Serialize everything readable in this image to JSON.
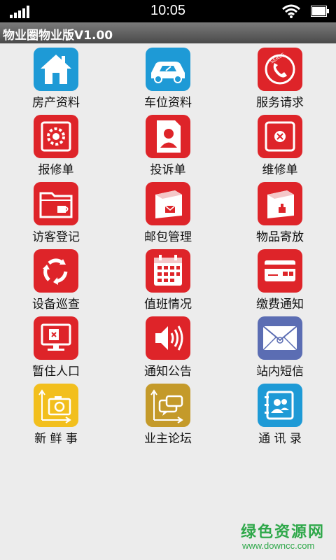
{
  "status_bar": {
    "time": "10:05",
    "icons": [
      "signal-icon",
      "wifi-icon",
      "battery-icon"
    ]
  },
  "title_bar": {
    "title": "物业圈物业版V1.00"
  },
  "menu": [
    {
      "label": "房产资料",
      "icon": "house-icon",
      "color": "#1e9ad6"
    },
    {
      "label": "车位资料",
      "icon": "car-icon",
      "color": "#1e9ad6"
    },
    {
      "label": "服务请求",
      "icon": "phone-serve-icon",
      "color": "#de2429"
    },
    {
      "label": "报修单",
      "icon": "gear-repair-icon",
      "color": "#de2429"
    },
    {
      "label": "投诉单",
      "icon": "complaint-person-icon",
      "color": "#de2429"
    },
    {
      "label": "维修单",
      "icon": "safe-box-icon",
      "color": "#de2429"
    },
    {
      "label": "访客登记",
      "icon": "folder-cup-icon",
      "color": "#de2429"
    },
    {
      "label": "邮包管理",
      "icon": "package-mail-icon",
      "color": "#de2429"
    },
    {
      "label": "物品寄放",
      "icon": "storage-box-icon",
      "color": "#de2429"
    },
    {
      "label": "设备巡查",
      "icon": "recycle-arrows-icon",
      "color": "#de2429"
    },
    {
      "label": "值班情况",
      "icon": "calendar-icon",
      "color": "#de2429"
    },
    {
      "label": "缴费通知",
      "icon": "card-icon",
      "color": "#de2429"
    },
    {
      "label": "暂住人口",
      "icon": "monitor-icon",
      "color": "#de2429"
    },
    {
      "label": "通知公告",
      "icon": "speaker-icon",
      "color": "#de2429"
    },
    {
      "label": "站内短信",
      "icon": "envelope-icon",
      "color": "#5b6db3"
    },
    {
      "label": "新 鲜 事",
      "icon": "camera-share-icon",
      "color": "#f2bf1d"
    },
    {
      "label": "业主论坛",
      "icon": "chat-share-icon",
      "color": "#c49a2a"
    },
    {
      "label": "通 讯 录",
      "icon": "contacts-icon",
      "color": "#1e9ad6"
    }
  ],
  "watermark": {
    "main": "绿色资源网",
    "sub": "www.downcc.com"
  }
}
